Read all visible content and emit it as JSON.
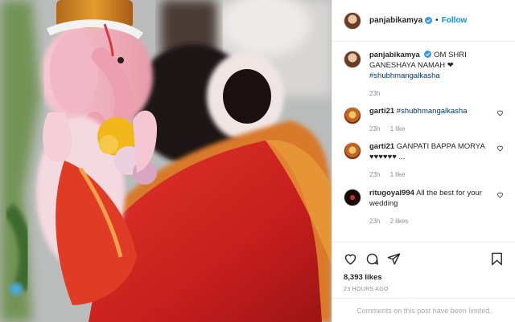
{
  "post": {
    "username": "panjabikamya",
    "follow_label": "Follow",
    "separator": "•",
    "caption_text": "OM SHRI GANESHAYA NAMAH ❤",
    "caption_hashtag": "#shubhmangalkasha",
    "caption_time": "23h"
  },
  "comments": [
    {
      "user": "garti21",
      "text": "",
      "tag": "#shubhmangalkasha",
      "time": "23h",
      "likes": "1 like"
    },
    {
      "user": "garti21",
      "text": "GANPATI BAPPA MORYA ♥♥♥♥♥♥ ...",
      "tag": "",
      "time": "23h",
      "likes": "1 like"
    },
    {
      "user": "ritugoyal994",
      "text": "All the best for your wedding",
      "tag": "",
      "time": "23h",
      "likes": "2 likes"
    }
  ],
  "actions": {
    "like_count": "8,393 likes",
    "posted_ago": "23 HOURS AGO",
    "comments_limited": "Comments on this post have been limited."
  },
  "icons": [
    "verified-badge-icon",
    "heart-icon",
    "comment-icon",
    "share-icon",
    "bookmark-icon"
  ],
  "colors": {
    "link_blue": "#0095f6",
    "hashtag": "#00376b",
    "muted": "#8e8e8e"
  }
}
